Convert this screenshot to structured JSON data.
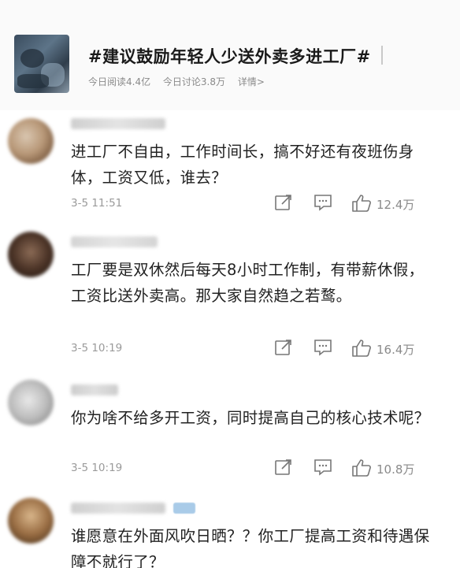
{
  "topic": {
    "title": "#建议鼓励年轻人少送外卖多进工厂#",
    "reads": "今日阅读4.4亿",
    "discussions": "今日讨论3.8万",
    "details": "详情>"
  },
  "comments": [
    {
      "text": "进工厂不自由，工作时间长，搞不好还有夜班伤身体，工资又低，谁去？",
      "time": "3-5 11:51",
      "likes": "12.4万"
    },
    {
      "text": "工厂要是双休然后每天8小时工作制，有带薪休假，工资比送外卖高。那大家自然趋之若鹜。",
      "time": "3-5 10:19",
      "likes": "16.4万"
    },
    {
      "text": "你为啥不给多开工资，同时提高自己的核心技术呢？",
      "time": "3-5 10:19",
      "likes": "10.8万"
    },
    {
      "text": "谁愿意在外面风吹日晒？？你工厂提高工资和待遇保障不就行了？",
      "time": "",
      "likes": ""
    }
  ],
  "icons": {
    "share": "share-icon",
    "comment": "comment-icon",
    "like": "thumbs-up-icon"
  }
}
